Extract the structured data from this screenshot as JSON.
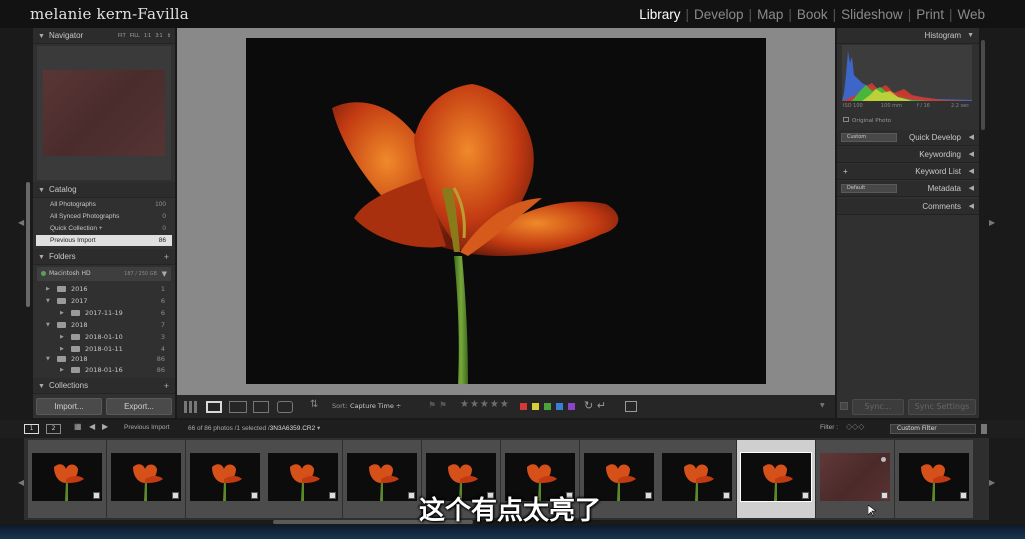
{
  "app": {
    "identity_plate": "melanie kern-Favilla"
  },
  "modules": [
    {
      "label": "Library",
      "active": true
    },
    {
      "label": "Develop",
      "active": false
    },
    {
      "label": "Map",
      "active": false
    },
    {
      "label": "Book",
      "active": false
    },
    {
      "label": "Slideshow",
      "active": false
    },
    {
      "label": "Print",
      "active": false
    },
    {
      "label": "Web",
      "active": false
    }
  ],
  "navigator": {
    "title": "Navigator",
    "zoom_options": "FIT FILL 1:1 3:1 ⇕"
  },
  "catalog": {
    "title": "Catalog",
    "items": [
      {
        "label": "All Photographs",
        "count": "100"
      },
      {
        "label": "All Synced Photographs",
        "count": "0"
      },
      {
        "label": "Quick Collection +",
        "count": "0"
      },
      {
        "label": "Previous Import",
        "count": "86",
        "selected": true
      }
    ]
  },
  "folders": {
    "title": "Folders",
    "volume": {
      "name": "Macintosh HD",
      "info": "187 / 250 GB"
    },
    "items": [
      {
        "label": "2016",
        "count": "1"
      },
      {
        "label": "2017",
        "count": "6"
      },
      {
        "label": "2017-11-19",
        "count": "6"
      },
      {
        "label": "2018",
        "count": "7"
      },
      {
        "label": "2018-01-10",
        "count": "3"
      },
      {
        "label": "2018-01-11",
        "count": "4"
      },
      {
        "label": "2018",
        "count": "86"
      },
      {
        "label": "2018-01-16",
        "count": "86"
      }
    ]
  },
  "collections": {
    "title": "Collections"
  },
  "left_buttons": {
    "import": "Import...",
    "export": "Export..."
  },
  "toolbar": {
    "sort_label": "Sort:",
    "sort_value": "Capture Time ÷",
    "stars": "★★★★★"
  },
  "color_labels": [
    "#d23a3a",
    "#d6cf35",
    "#4aa33b",
    "#3a7fd6",
    "#8a44c6"
  ],
  "right_panel": {
    "histogram_title": "Histogram",
    "hist_info": {
      "iso": "ISO 100",
      "focal": "100 mm",
      "aperture": "f / 16",
      "shutter": "2.2 sec"
    },
    "original_photo": "Original Photo",
    "quick_develop": {
      "title": "Quick Develop",
      "preset": "Custom"
    },
    "keywording": "Keywording",
    "keyword_list": "Keyword List",
    "metadata": {
      "title": "Metadata",
      "preset": "Default"
    },
    "comments": "Comments",
    "sync": "Sync...",
    "sync_settings": "Sync Settings"
  },
  "filmstrip_header": {
    "screen1": "1",
    "screen2": "2",
    "source": "Previous Import",
    "info_prefix": "66 of 86 photos /1 selected /",
    "filename": "3N3A6359.CR2",
    "filter_label": "Filter :",
    "filter_value": "Custom Filter"
  },
  "filmstrip_thumbs": [
    {
      "kind": "tulip"
    },
    {
      "kind": "tulip"
    },
    {
      "kind": "tulip"
    },
    {
      "kind": "tulip"
    },
    {
      "kind": "tulip"
    },
    {
      "kind": "tulip"
    },
    {
      "kind": "tulip"
    },
    {
      "kind": "tulip"
    },
    {
      "kind": "tulip"
    },
    {
      "kind": "tulip",
      "selected": true
    },
    {
      "kind": "red"
    },
    {
      "kind": "tulip"
    }
  ],
  "subtitle": "这个有点太亮了"
}
